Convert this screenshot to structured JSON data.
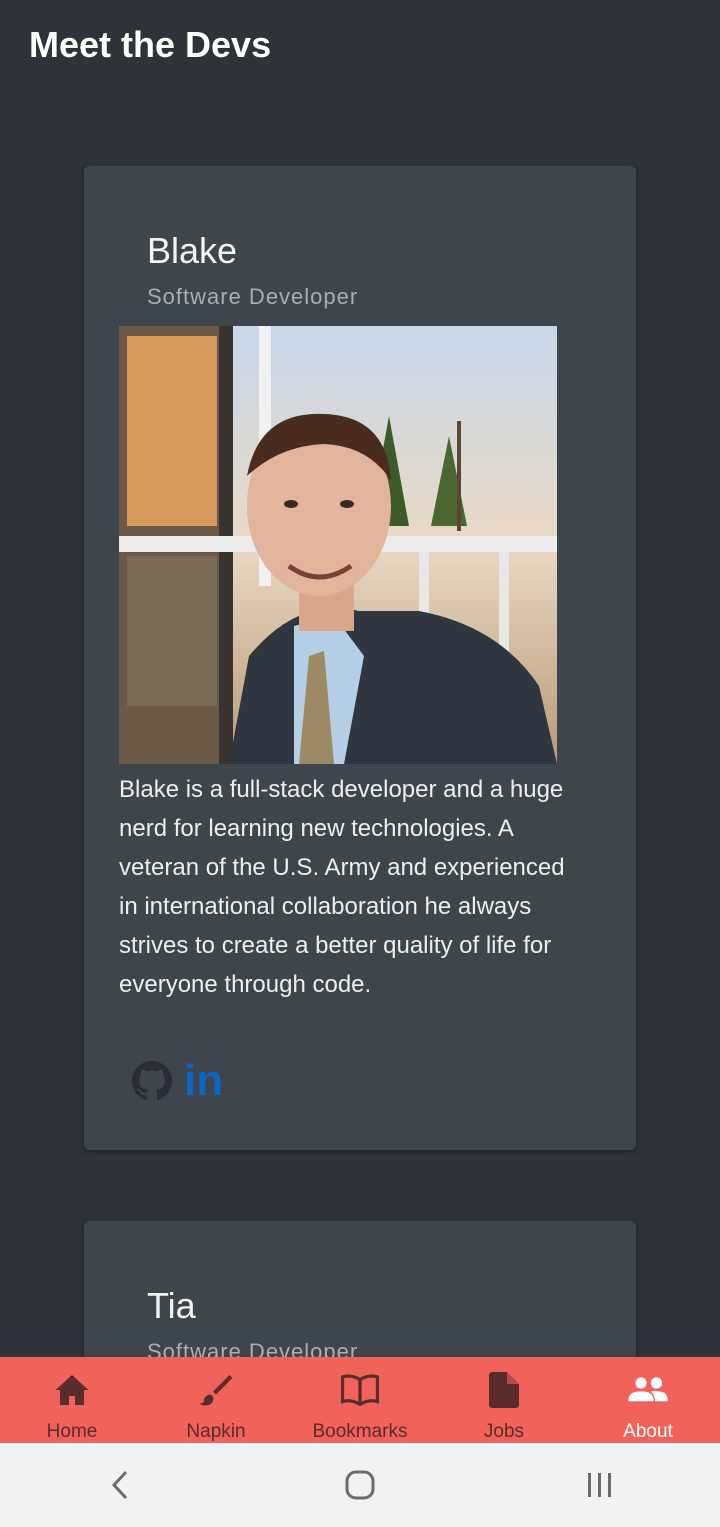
{
  "header": {
    "title": "Meet the Devs"
  },
  "devs": [
    {
      "name": "Blake",
      "role": "Software Developer",
      "bio": "Blake is a full-stack developer and a huge nerd for learning new technologies. A veteran of the U.S. Army and experienced in international collaboration he always strives to create a better quality of life for everyone through code.",
      "links": [
        {
          "icon": "github-icon",
          "label": "GitHub"
        },
        {
          "icon": "linkedin-icon",
          "label": "in"
        }
      ]
    },
    {
      "name": "Tia",
      "role": "Software Developer"
    }
  ],
  "bottom_nav": {
    "items": [
      {
        "label": "Home",
        "icon": "home-icon"
      },
      {
        "label": "Napkin",
        "icon": "brush-icon"
      },
      {
        "label": "Bookmarks",
        "icon": "book-icon"
      },
      {
        "label": "Jobs",
        "icon": "document-icon"
      },
      {
        "label": "About",
        "icon": "people-icon"
      }
    ],
    "active": "About"
  },
  "colors": {
    "background": "#2e333a",
    "card": "#3f454d",
    "nav_background": "#f1625a",
    "linkedin": "#0a66c2"
  }
}
